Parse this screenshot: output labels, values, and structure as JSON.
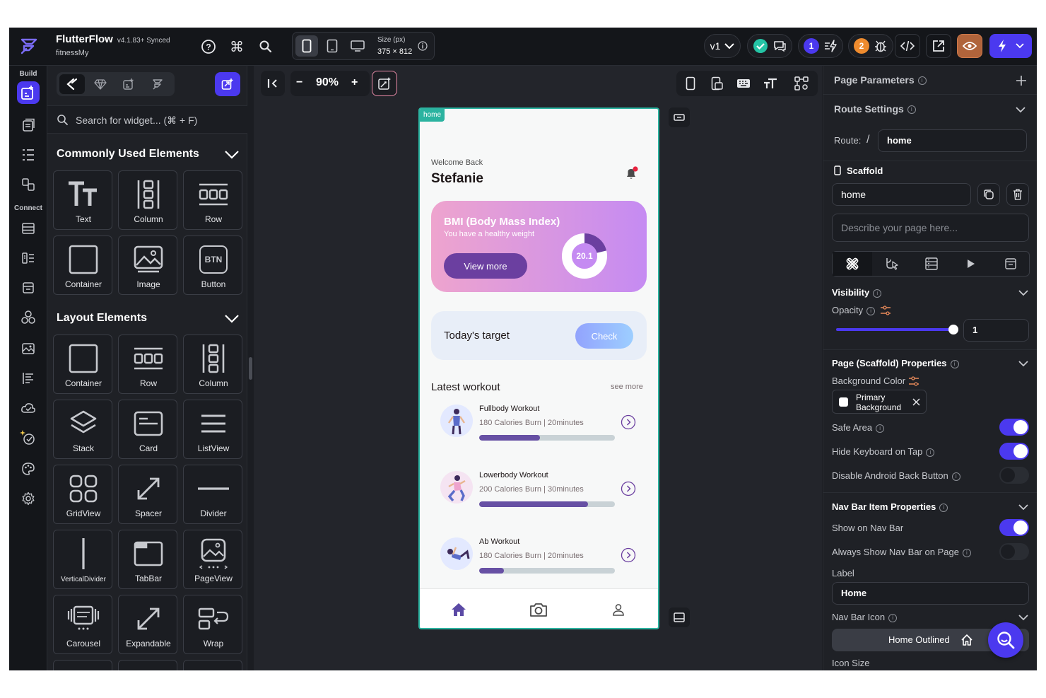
{
  "header": {
    "app_name": "FlutterFlow",
    "version": "v4.1.83+ Synced",
    "project": "fitnessMy",
    "size_label": "Size (px)",
    "size_value": "375 × 812",
    "branch": "v1",
    "comments_badge": "1",
    "bugs_badge": "2",
    "accent_color": "#4b39ef"
  },
  "rail": {
    "build_label": "Build",
    "connect_label": "Connect"
  },
  "widget_panel": {
    "search_placeholder": "Search for widget... (⌘ + F)",
    "common_title": "Commonly Used Elements",
    "common_items": [
      "Text",
      "Column",
      "Row",
      "Container",
      "Image",
      "Button"
    ],
    "button_glyph": "BTN",
    "layout_title": "Layout Elements",
    "layout_items": [
      "Container",
      "Row",
      "Column",
      "Stack",
      "Card",
      "ListView",
      "GridView",
      "Spacer",
      "Divider",
      "VerticalDivider",
      "TabBar",
      "PageView",
      "Carousel",
      "Expandable",
      "Wrap"
    ]
  },
  "canvas": {
    "zoom_minus": "−",
    "zoom_level": "90%",
    "zoom_plus": "+"
  },
  "phone": {
    "page_tag": "home",
    "welcome": "Welcome Back",
    "user_name": "Stefanie",
    "bmi_title": "BMI (Body Mass Index)",
    "bmi_subtitle": "You have a healthy weight",
    "bmi_button": "View more",
    "bmi_value": "20.1",
    "target_label": "Today's target",
    "target_button": "Check",
    "latest_title": "Latest workout",
    "see_more": "see more",
    "workouts": [
      {
        "name": "Fullbody Workout",
        "detail": "180 Calories Burn | 20minutes",
        "progress": 0.45
      },
      {
        "name": "Lowerbody Workout",
        "detail": "200 Calories Burn | 30minutes",
        "progress": 0.8
      },
      {
        "name": "Ab Workout",
        "detail": "180 Calories Burn | 20minutes",
        "progress": 0.18
      }
    ]
  },
  "properties": {
    "page_parameters": "Page Parameters",
    "route_settings": "Route Settings",
    "route_label": "Route:",
    "route_slash": "/",
    "route_value": "home",
    "scaffold_title": "Scaffold",
    "scaffold_name": "home",
    "describe_placeholder": "Describe your page here...",
    "visibility": "Visibility",
    "opacity": "Opacity",
    "opacity_value": "1",
    "scaffold_props": "Page (Scaffold) Properties",
    "bg_color": "Background Color",
    "bg_value_line1": "Primary",
    "bg_value_line2": "Background",
    "safe_area": "Safe Area",
    "hide_keyboard": "Hide Keyboard on Tap",
    "disable_back": "Disable Android Back Button",
    "nav_props": "Nav Bar Item Properties",
    "show_nav": "Show on Nav Bar",
    "always_show_nav": "Always Show Nav Bar on Page",
    "label_title": "Label",
    "label_value": "Home",
    "nav_icon": "Nav Bar Icon",
    "nav_icon_value": "Home Outlined",
    "icon_size": "Icon Size"
  }
}
